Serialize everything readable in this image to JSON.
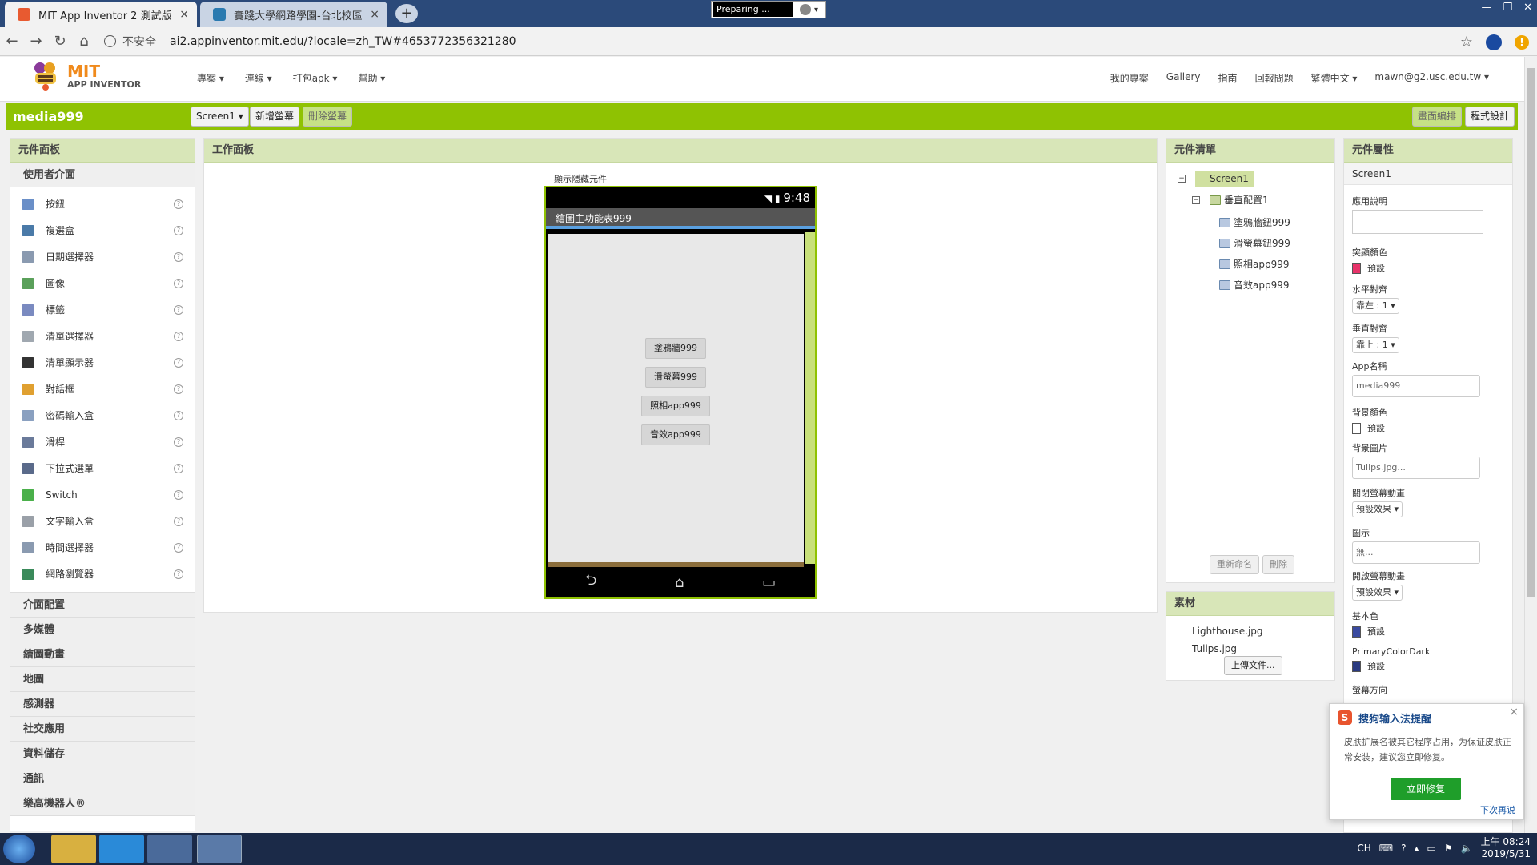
{
  "browser": {
    "tabs": [
      {
        "title": "MIT App Inventor 2 測試版",
        "close": "×"
      },
      {
        "title": "實踐大學網路學園-台北校區",
        "close": "×"
      }
    ],
    "new_tab": "+",
    "preparing_text": "Preparing ...",
    "insecure_label": "不安全",
    "url": "ai2.appinventor.mit.edu/?locale=zh_TW#4653772356321280"
  },
  "topnav": {
    "logo_mit": "MIT",
    "logo_sub": "APP INVENTOR",
    "menu_left": [
      "專案 ▾",
      "連線 ▾",
      "打包apk ▾",
      "幫助 ▾"
    ],
    "menu_right": [
      "我的專案",
      "Gallery",
      "指南",
      "回報問題",
      "繁體中文 ▾",
      "mawn@g2.usc.edu.tw ▾"
    ]
  },
  "projbar": {
    "project_name": "media999",
    "screen_select": "Screen1 ▾",
    "add_screen": "新增螢幕",
    "remove_screen": "刪除螢幕",
    "designer": "畫面編排",
    "blocks": "程式設計"
  },
  "palette": {
    "header": "元件面板",
    "open_category": "使用者介面",
    "items": [
      {
        "label": "按鈕",
        "color": "#6a8fc8"
      },
      {
        "label": "複選盒",
        "color": "#4a7aa8"
      },
      {
        "label": "日期選擇器",
        "color": "#8a9ab0"
      },
      {
        "label": "圖像",
        "color": "#5aa05a"
      },
      {
        "label": "標籤",
        "color": "#7a8ac0"
      },
      {
        "label": "清單選擇器",
        "color": "#a0a8b0"
      },
      {
        "label": "清單顯示器",
        "color": "#333333"
      },
      {
        "label": "對話框",
        "color": "#e0a030"
      },
      {
        "label": "密碼輸入盒",
        "color": "#8aa0c0"
      },
      {
        "label": "滑桿",
        "color": "#6a7a9a"
      },
      {
        "label": "下拉式選單",
        "color": "#5a6a8a"
      },
      {
        "label": "Switch",
        "color": "#4ab04a"
      },
      {
        "label": "文字輸入盒",
        "color": "#9aa0a8"
      },
      {
        "label": "時間選擇器",
        "color": "#8a9ab0"
      },
      {
        "label": "網路瀏覽器",
        "color": "#3a8a5a"
      }
    ],
    "help_glyph": "?",
    "categories": [
      "介面配置",
      "多媒體",
      "繪圖動畫",
      "地圖",
      "感測器",
      "社交應用",
      "資料儲存",
      "通訊",
      "樂高機器人®"
    ]
  },
  "viewer": {
    "header": "工作面板",
    "show_hidden": "顯示隱藏元件",
    "phone_time": "9:48",
    "screen_title": "繪圖主功能表999",
    "buttons": [
      "塗鴉牆999",
      "滑螢幕999",
      "照相app999",
      "音效app999"
    ],
    "nav_back": "⮌",
    "nav_home": "⌂",
    "nav_recent": "▭"
  },
  "components": {
    "header": "元件清單",
    "screen": "Screen1",
    "arrangement": "垂直配置1",
    "children": [
      "塗鴉牆鈕999",
      "滑螢幕鈕999",
      "照相app999",
      "音效app999"
    ],
    "rename": "重新命名",
    "delete": "刪除"
  },
  "media": {
    "header": "素材",
    "files": [
      "Lighthouse.jpg",
      "Tulips.jpg"
    ],
    "upload": "上傳文件..."
  },
  "properties": {
    "header": "元件屬性",
    "component": "Screen1",
    "about_label": "應用說明",
    "accent_label": "突顯顏色",
    "accent_value": "預設",
    "accent_color": "#e8336a",
    "align_h_label": "水平對齊",
    "align_h_value": "靠左 : 1 ▾",
    "align_v_label": "垂直對齊",
    "align_v_value": "靠上 : 1 ▾",
    "appname_label": "App名稱",
    "appname_value": "media999",
    "bgcolor_label": "背景顏色",
    "bgcolor_value": "預設",
    "bgimage_label": "背景圖片",
    "bgimage_value": "Tulips.jpg...",
    "close_anim_label": "關閉螢幕動畫",
    "close_anim_value": "預設效果 ▾",
    "icon_label": "圖示",
    "icon_value": "無...",
    "open_anim_label": "開啟螢幕動畫",
    "open_anim_value": "預設效果 ▾",
    "primary_label": "基本色",
    "primary_value": "預設",
    "primary_color": "#3a4aa0",
    "primary_dark_label": "PrimaryColorDark",
    "primary_dark_value": "預設",
    "primary_dark_color": "#2a3a80",
    "orientation_label": "螢幕方向"
  },
  "sogou": {
    "logo": "S",
    "title": "搜狗输入法提醒",
    "message": "皮肤扩展名被其它程序占用，为保证皮肤正常安装，建议您立即修复。",
    "fix": "立即修复",
    "later": "下次再说",
    "close": "×"
  },
  "taskbar": {
    "tray_lang": "CH",
    "time": "上午 08:24",
    "date": "2019/5/31"
  }
}
